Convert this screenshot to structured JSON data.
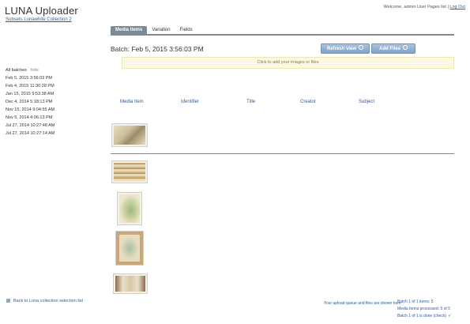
{
  "app": {
    "title": "LUNA Uploader",
    "collection_link": "Subsets Lunawhite Collection 2"
  },
  "header": {
    "welcome_text": "Welcome, admin User Pages list",
    "logout": "Log Out"
  },
  "tabs": [
    {
      "label": "Media Items",
      "active": true
    },
    {
      "label": "Variation",
      "active": false
    },
    {
      "label": "Fields",
      "active": false
    }
  ],
  "batch": {
    "title": "Batch: Feb 5, 2015 3:56:03 PM"
  },
  "toolbar": {
    "refresh_label": "Refresh view",
    "add_label": "Add Files"
  },
  "notice": {
    "text": "Click to add your images or files"
  },
  "batches_panel": {
    "header": "All batches",
    "toggle": "hide",
    "items": [
      "Feb 5, 2015 3:56:03 PM",
      "Feb 4, 2015 11:30:28 PM",
      "Jan 15, 2015 9:53:38 AM",
      "Dec 4, 2014 5:18:13 PM",
      "Nov 15, 2014 9:04:55 AM",
      "Nov 5, 2014 4:06:13 PM",
      "Jul 27, 2014 10:27:48 AM",
      "Jul 27, 2014 10:27:14 AM"
    ]
  },
  "table": {
    "columns": [
      "Media Item",
      "Identifier",
      "Title",
      "Creator",
      "Subject"
    ]
  },
  "thumbnails": [
    {
      "name": "map-image-1",
      "color_a": "#e6dcc2",
      "color_b": "#9b8b6a"
    },
    {
      "name": "map-image-2",
      "color_a": "#e8d9b8",
      "color_b": "#7aa0a8"
    },
    {
      "name": "map-image-3",
      "color_a": "#efe6cf",
      "color_b": "#9db87c"
    },
    {
      "name": "map-image-4",
      "color_a": "#c9a779",
      "color_b": "#e7dcc0"
    },
    {
      "name": "map-image-5",
      "color_a": "#e9dfc6",
      "color_b": "#8d6c4f"
    }
  ],
  "footer": {
    "left_link": "Back to Luna collection selection list",
    "mid_link": "Your upload queue and files are shown here",
    "right_lines": [
      "Batch 1 of 1 items: 5",
      "Media Items processed: 5 of 5",
      "Batch 1 of 1 is done (check)"
    ]
  },
  "colors": {
    "accent_blue": "#2a5d9f",
    "button_blue": "#8fb0d4",
    "notice_bg": "#fbf8e3",
    "tab_active": "#7a8a99"
  }
}
